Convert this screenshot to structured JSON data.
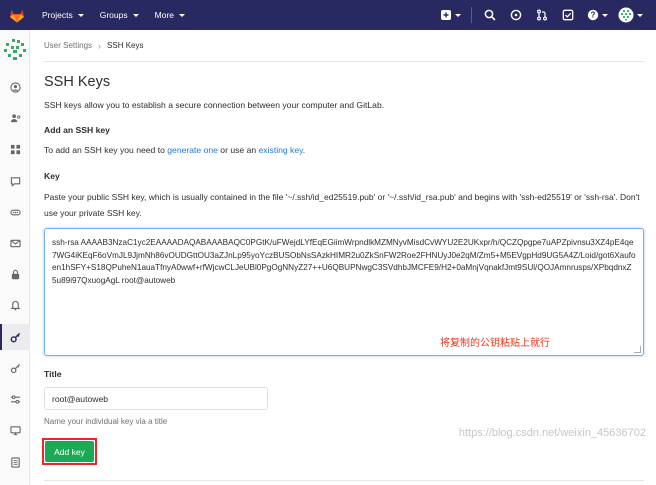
{
  "nav": {
    "menu": [
      "Projects",
      "Groups",
      "More"
    ]
  },
  "breadcrumb": {
    "parent": "User Settings",
    "current": "SSH Keys"
  },
  "page": {
    "title": "SSH Keys",
    "description": "SSH keys allow you to establish a secure connection between your computer and GitLab.",
    "add_heading": "Add an SSH key",
    "add_text_before": "To add an SSH key you need to ",
    "generate_link": "generate one",
    "add_text_middle": " or use an ",
    "existing_link": "existing key",
    "add_text_after": "."
  },
  "key_form": {
    "label": "Key",
    "paste_hint": "Paste your public SSH key, which is usually contained in the file '~/.ssh/id_ed25519.pub' or '~/.ssh/id_rsa.pub' and begins with 'ssh-ed25519' or 'ssh-rsa'. Don't use your private SSH key.",
    "key_value": "ssh-rsa AAAAB3NzaC1yc2EAAAADAQABAAABAQC0PGtK/uFWejdLYfEqEGiimWrpndlkMZMNyvMisdCvWYU2E2UKxpr/h/QCZQpgpe7uAPZpivnsu3XZ4pE4qe7WG4iKEqF6oVmJL9JjmNh86vOUDGttOU3aZJnLp95yoYczBUSObNsSAzkHIMR2u0ZkSnFW2Roe2FHNUyJ0e2qM/Zm5+M5EVgpHd9UG5A4Z/Loid/got6Xaufoen1hSFY+S18QPuheN1auaTfnyA0wwf+rfWjcwCLJeUBl0PgOgNNyZ27++U6QBUPNwgC3SVdhbJMCFE9/H2+0aMnjVqnakfJmt9SUl/QOJAmnrusps/XPbqdnxZ5u89i97QxuogAgL root@autoweb",
    "annotation": "将复制的公钥粘贴上就行"
  },
  "title_field": {
    "label": "Title",
    "value": "root@autoweb",
    "help": "Name your individual key via a title"
  },
  "submit": {
    "label": "Add key"
  },
  "watermark": "https://blog.csdn.net/weixin_45636702",
  "colors": {
    "navbar": "#292961",
    "link": "#1f78d1",
    "button": "#1aaa55",
    "annotation": "#e8361a"
  }
}
